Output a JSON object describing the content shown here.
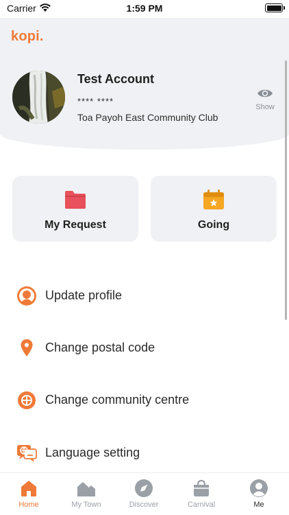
{
  "status_bar": {
    "carrier": "Carrier",
    "time": "1:59 PM"
  },
  "app": {
    "logo": "kopi.",
    "brand_color": "#ef7a38"
  },
  "profile": {
    "name": "Test Account",
    "masked_id": "**** ****",
    "community_club": "Toa Payoh East Community Club",
    "show_label": "Show"
  },
  "cards": [
    {
      "label": "My Request",
      "icon": "folder-icon",
      "color": "#e8505b"
    },
    {
      "label": "Going",
      "icon": "calendar-star-icon",
      "color": "#f5a623"
    }
  ],
  "menu": [
    {
      "label": "Update profile",
      "icon": "person-icon"
    },
    {
      "label": "Change postal code",
      "icon": "location-pin-icon"
    },
    {
      "label": "Change community centre",
      "icon": "community-centre-icon"
    },
    {
      "label": "Language setting",
      "icon": "language-icon"
    }
  ],
  "tabs": [
    {
      "label": "Home",
      "icon": "home-icon",
      "active": true
    },
    {
      "label": "My Town",
      "icon": "town-icon",
      "active": false
    },
    {
      "label": "Discover",
      "icon": "compass-icon",
      "active": false
    },
    {
      "label": "Carnival",
      "icon": "bag-icon",
      "active": false
    },
    {
      "label": "Me",
      "icon": "user-icon",
      "active": false
    }
  ]
}
